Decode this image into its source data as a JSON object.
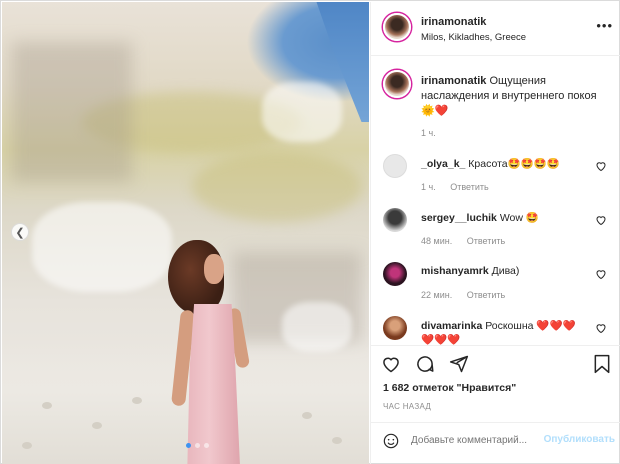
{
  "post": {
    "username": "irinamonatik",
    "location": "Milos, Kikladhes, Greece",
    "caption_text": "Ощущения наслаждения и внутреннего покоя",
    "caption_emoji": "🌞❤️",
    "caption_time": "1 ч."
  },
  "comments": [
    {
      "username": "_olya_k_",
      "text": "Красота🤩🤩🤩🤩",
      "time": "1 ч.",
      "reply": "Ответить"
    },
    {
      "username": "sergey__luchik",
      "text": "Wow 🤩",
      "time": "48 мин.",
      "reply": "Ответить"
    },
    {
      "username": "mishanyamrk",
      "text": "Дива)",
      "time": "22 мин.",
      "reply": "Ответить"
    },
    {
      "username": "divamarinka",
      "text": "Роскошна ❤️❤️❤️",
      "text2": "❤️❤️❤️"
    }
  ],
  "actions": {
    "likes": "1 682 отметок \"Нравится\"",
    "posted": "ЧАС НАЗАД",
    "comment_placeholder": "Добавьте комментарий...",
    "publish": "Опубликовать"
  },
  "icons": {
    "more": "more-horizontal-icon",
    "heart": "heart-icon",
    "comment": "comment-icon",
    "share": "share-icon",
    "bookmark": "bookmark-icon",
    "emoji": "emoji-icon",
    "carousel_prev": "chevron-left-icon"
  },
  "colors": {
    "accent_blue": "#3e93f0",
    "publish_disabled": "#b2dffc",
    "muted": "#8e8e8e"
  }
}
